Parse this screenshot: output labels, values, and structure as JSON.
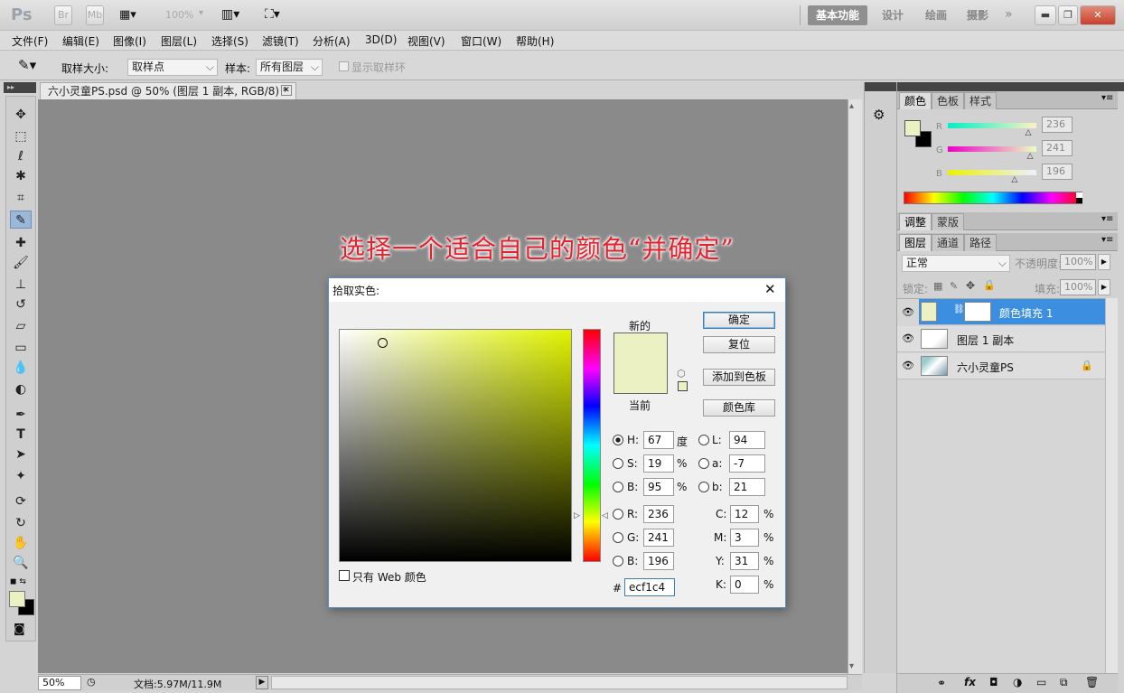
{
  "app": {
    "logo": "Ps",
    "zoom": "100%",
    "workspaces": [
      "基本功能",
      "设计",
      "绘画",
      "摄影"
    ],
    "active_workspace": "基本功能"
  },
  "menu": [
    "文件(F)",
    "编辑(E)",
    "图像(I)",
    "图层(L)",
    "选择(S)",
    "滤镜(T)",
    "分析(A)",
    "3D(D)",
    "视图(V)",
    "窗口(W)",
    "帮助(H)"
  ],
  "options": {
    "sample_size_label": "取样大小:",
    "sample_size_value": "取样点",
    "sample_label": "样本:",
    "sample_value": "所有图层",
    "show_ring_label": "显示取样环"
  },
  "document": {
    "tab_title": "六小灵童PS.psd @ 50% (图层 1 副本, RGB/8) *",
    "canvas_color": "#ecf1c4",
    "annotation": "选择一个适合自己的颜色“并确定”",
    "zoom": "50%",
    "doc_size": "文档:5.97M/11.9M"
  },
  "picker": {
    "title": "拾取实色:",
    "new_label": "新的",
    "current_label": "当前",
    "color": "#ecf1c4",
    "buttons": {
      "ok": "确定",
      "reset": "复位",
      "add_swatch": "添加到色板",
      "libraries": "颜色库"
    },
    "web_only_label": "只有 Web 颜色",
    "H": {
      "label": "H:",
      "value": "67",
      "unit": "度"
    },
    "S": {
      "label": "S:",
      "value": "19",
      "unit": "%"
    },
    "B": {
      "label": "B:",
      "value": "95",
      "unit": "%"
    },
    "R": {
      "label": "R:",
      "value": "236"
    },
    "G": {
      "label": "G:",
      "value": "241"
    },
    "Bl": {
      "label": "B:",
      "value": "196"
    },
    "L": {
      "label": "L:",
      "value": "94"
    },
    "a": {
      "label": "a:",
      "value": "-7"
    },
    "b": {
      "label": "b:",
      "value": "21"
    },
    "C": {
      "label": "C:",
      "value": "12",
      "unit": "%"
    },
    "M": {
      "label": "M:",
      "value": "3",
      "unit": "%"
    },
    "Y": {
      "label": "Y:",
      "value": "31",
      "unit": "%"
    },
    "K": {
      "label": "K:",
      "value": "0",
      "unit": "%"
    },
    "hash": "#",
    "hex": "ecf1c4"
  },
  "color_panel": {
    "tabs": [
      "颜色",
      "色板",
      "样式"
    ],
    "r_label": "R",
    "g_label": "G",
    "b_label": "B",
    "r": "236",
    "g": "241",
    "b": "196",
    "r_level": 0.925,
    "g_level": 0.945,
    "b_level": 0.769
  },
  "adjust_panel": {
    "tabs": [
      "调整",
      "蒙版"
    ]
  },
  "layers_panel": {
    "tabs": [
      "图层",
      "通道",
      "路径"
    ],
    "blend_mode": "正常",
    "opacity_label": "不透明度:",
    "opacity": "100%",
    "lock_label": "锁定:",
    "fill_label": "填充:",
    "fill": "100%",
    "layers": [
      {
        "name": "颜色填充 1",
        "selected": true
      },
      {
        "name": "图层 1 副本",
        "selected": false
      },
      {
        "name": "六小灵童PS",
        "selected": false
      }
    ],
    "footer_icons": [
      "link-icon",
      "fx-icon",
      "mask-icon",
      "adjustment-icon",
      "folder-icon",
      "new-layer-icon",
      "trash-icon"
    ]
  }
}
